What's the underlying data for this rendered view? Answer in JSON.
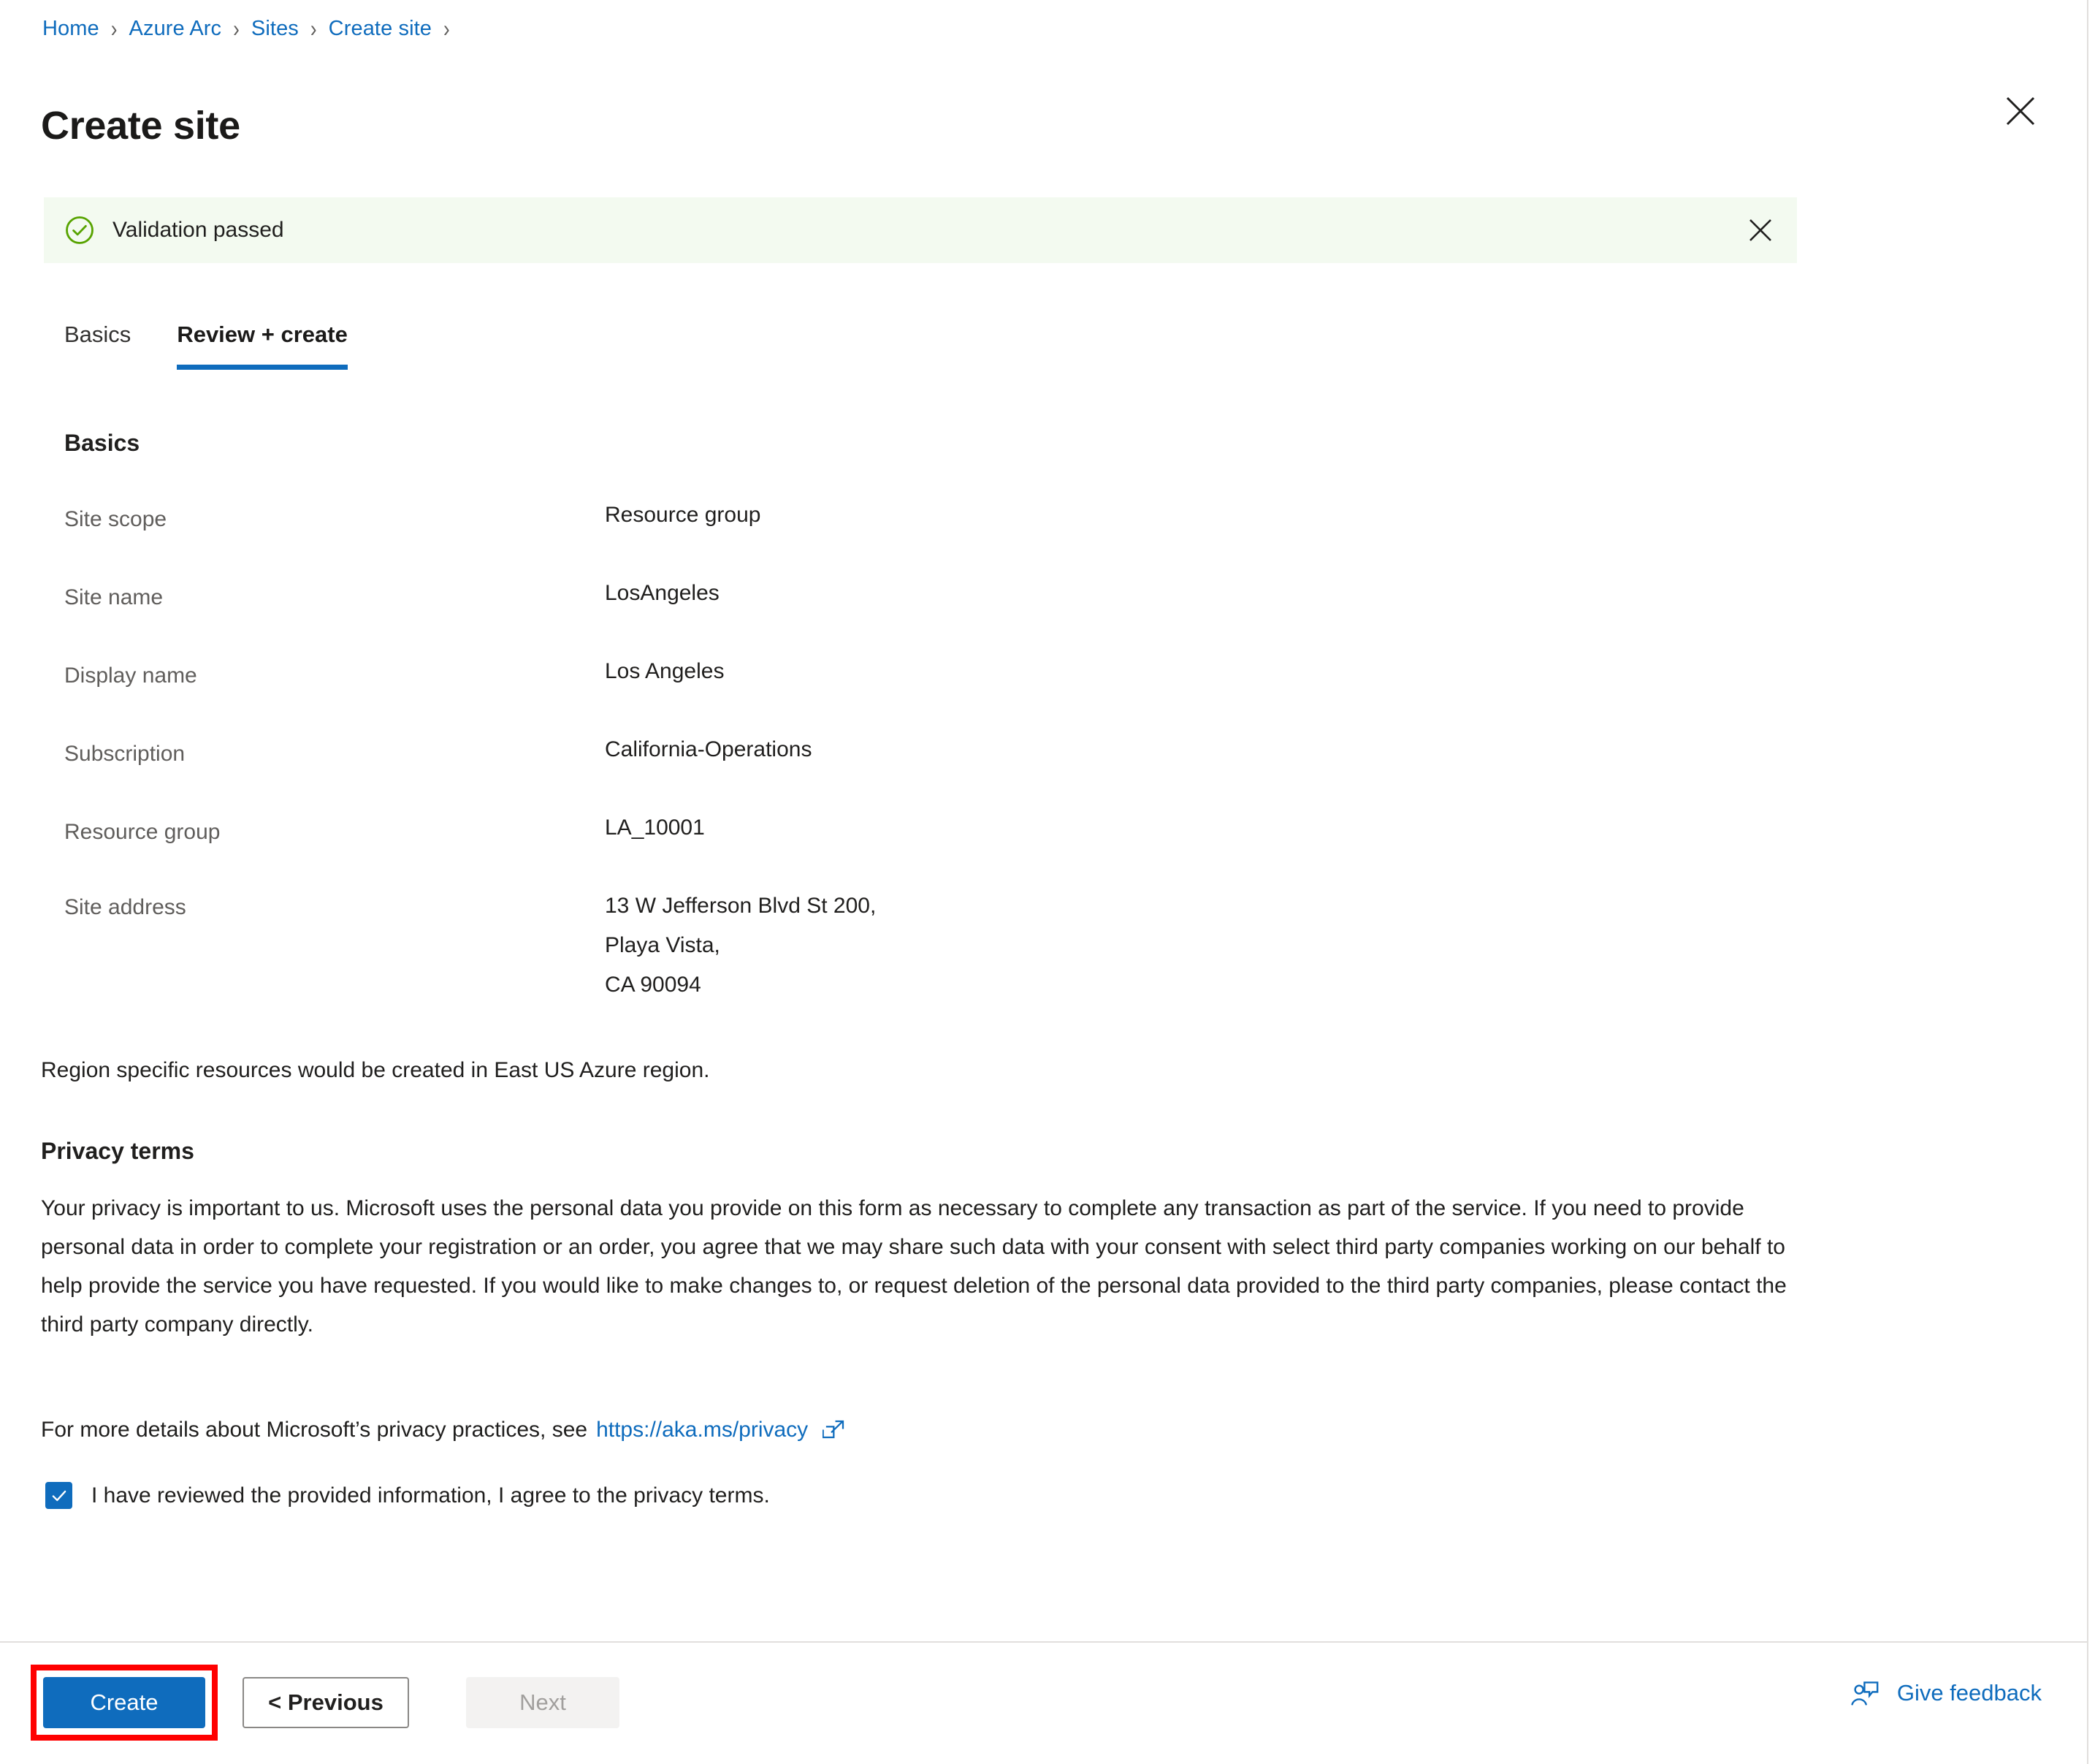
{
  "breadcrumb": {
    "items": [
      {
        "label": "Home"
      },
      {
        "label": "Azure Arc"
      },
      {
        "label": "Sites"
      },
      {
        "label": "Create site"
      }
    ],
    "separator": "›"
  },
  "header": {
    "title": "Create site",
    "close_icon": "close-icon"
  },
  "banner": {
    "icon": "check-circle-icon",
    "message": "Validation passed",
    "close_icon": "close-icon",
    "background_color": "#f3faf0",
    "icon_color": "#57a300"
  },
  "tabs": [
    {
      "label": "Basics",
      "active": false
    },
    {
      "label": "Review + create",
      "active": true
    }
  ],
  "sections": {
    "basics": {
      "heading": "Basics",
      "rows": [
        {
          "key": "Site scope",
          "value": "Resource group"
        },
        {
          "key": "Site name",
          "value": "LosAngeles"
        },
        {
          "key": "Display name",
          "value": "Los Angeles"
        },
        {
          "key": "Subscription",
          "value": "California-Operations"
        },
        {
          "key": "Resource group",
          "value": "LA_10001"
        }
      ],
      "address_row": {
        "key": "Site address",
        "lines": [
          "13 W Jefferson Blvd St 200,",
          "Playa Vista,",
          "CA 90094"
        ]
      }
    }
  },
  "region_note": "Region specific resources would be created in East US Azure region.",
  "privacy": {
    "heading": "Privacy terms",
    "body": "Your privacy is important to us. Microsoft uses the personal data you provide on this form as necessary to complete any transaction as part of the service. If you need to provide personal data in order to complete your registration or an order, you agree that we may share such data with your consent with select third party companies working on our behalf to help provide the service you have requested. If you would like to make changes to, or request deletion of the personal data provided to the third party companies, please contact the third party company directly.",
    "link_prefix": "For more details about Microsoft’s privacy practices, see",
    "link_text": "https://aka.ms/privacy",
    "link_icon": "external-link-icon",
    "consent": {
      "checked": true,
      "check_icon": "checkmark-icon",
      "label": "I have reviewed the provided information, I agree to the privacy terms."
    }
  },
  "footer": {
    "create_label": "Create",
    "previous_label": "< Previous",
    "next_label": "Next",
    "next_disabled": true,
    "feedback_label": "Give feedback",
    "feedback_icon": "person-feedback-icon",
    "highlight_color": "#ff0000"
  },
  "colors": {
    "accent": "#0f6cbd",
    "link": "#0f6cbd",
    "success": "#57a300",
    "text_primary": "#201f1e",
    "text_secondary": "#605e5c",
    "divider": "#e1dfdd",
    "disabled_bg": "#f3f2f1",
    "disabled_text": "#a19f9d"
  }
}
